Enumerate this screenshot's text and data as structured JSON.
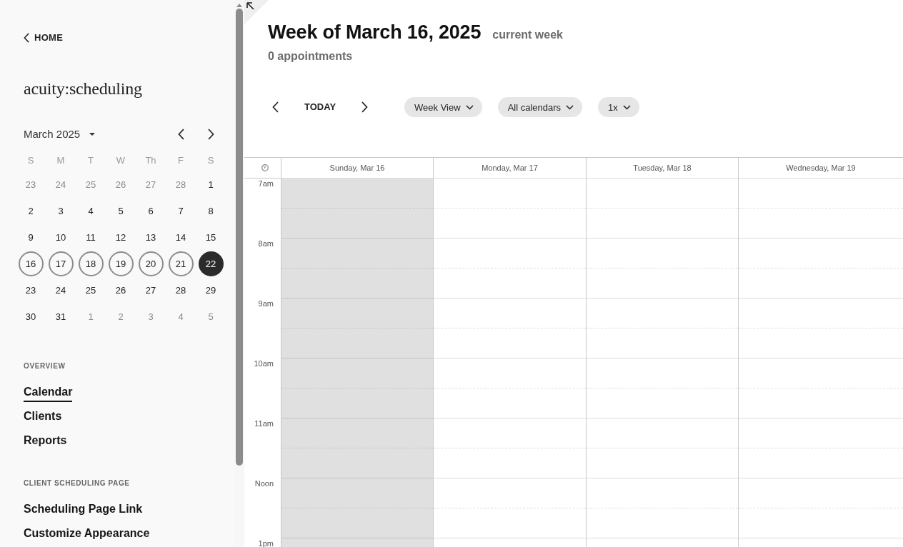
{
  "sidebar": {
    "back_link": {
      "label": "HOME"
    },
    "logo": "acuity:scheduling",
    "mini_calendar": {
      "month_label": "March 2025",
      "weekdays": [
        "S",
        "M",
        "T",
        "W",
        "Th",
        "F",
        "S"
      ],
      "weeks": [
        [
          {
            "label": "23",
            "other_month": true,
            "in_week": false,
            "today": false
          },
          {
            "label": "24",
            "other_month": true,
            "in_week": false,
            "today": false
          },
          {
            "label": "25",
            "other_month": true,
            "in_week": false,
            "today": false
          },
          {
            "label": "26",
            "other_month": true,
            "in_week": false,
            "today": false
          },
          {
            "label": "27",
            "other_month": true,
            "in_week": false,
            "today": false
          },
          {
            "label": "28",
            "other_month": true,
            "in_week": false,
            "today": false
          },
          {
            "label": "1",
            "other_month": false,
            "in_week": false,
            "today": false
          }
        ],
        [
          {
            "label": "2",
            "other_month": false,
            "in_week": false,
            "today": false
          },
          {
            "label": "3",
            "other_month": false,
            "in_week": false,
            "today": false
          },
          {
            "label": "4",
            "other_month": false,
            "in_week": false,
            "today": false
          },
          {
            "label": "5",
            "other_month": false,
            "in_week": false,
            "today": false
          },
          {
            "label": "6",
            "other_month": false,
            "in_week": false,
            "today": false
          },
          {
            "label": "7",
            "other_month": false,
            "in_week": false,
            "today": false
          },
          {
            "label": "8",
            "other_month": false,
            "in_week": false,
            "today": false
          }
        ],
        [
          {
            "label": "9",
            "other_month": false,
            "in_week": false,
            "today": false
          },
          {
            "label": "10",
            "other_month": false,
            "in_week": false,
            "today": false
          },
          {
            "label": "11",
            "other_month": false,
            "in_week": false,
            "today": false
          },
          {
            "label": "12",
            "other_month": false,
            "in_week": false,
            "today": false
          },
          {
            "label": "13",
            "other_month": false,
            "in_week": false,
            "today": false
          },
          {
            "label": "14",
            "other_month": false,
            "in_week": false,
            "today": false
          },
          {
            "label": "15",
            "other_month": false,
            "in_week": false,
            "today": false
          }
        ],
        [
          {
            "label": "16",
            "other_month": false,
            "in_week": true,
            "today": false
          },
          {
            "label": "17",
            "other_month": false,
            "in_week": true,
            "today": false
          },
          {
            "label": "18",
            "other_month": false,
            "in_week": true,
            "today": false
          },
          {
            "label": "19",
            "other_month": false,
            "in_week": true,
            "today": false
          },
          {
            "label": "20",
            "other_month": false,
            "in_week": true,
            "today": false
          },
          {
            "label": "21",
            "other_month": false,
            "in_week": true,
            "today": false
          },
          {
            "label": "22",
            "other_month": false,
            "in_week": true,
            "today": true
          }
        ],
        [
          {
            "label": "23",
            "other_month": false,
            "in_week": false,
            "today": false
          },
          {
            "label": "24",
            "other_month": false,
            "in_week": false,
            "today": false
          },
          {
            "label": "25",
            "other_month": false,
            "in_week": false,
            "today": false
          },
          {
            "label": "26",
            "other_month": false,
            "in_week": false,
            "today": false
          },
          {
            "label": "27",
            "other_month": false,
            "in_week": false,
            "today": false
          },
          {
            "label": "28",
            "other_month": false,
            "in_week": false,
            "today": false
          },
          {
            "label": "29",
            "other_month": false,
            "in_week": false,
            "today": false
          }
        ],
        [
          {
            "label": "30",
            "other_month": false,
            "in_week": false,
            "today": false
          },
          {
            "label": "31",
            "other_month": false,
            "in_week": false,
            "today": false
          },
          {
            "label": "1",
            "other_month": true,
            "in_week": false,
            "today": false
          },
          {
            "label": "2",
            "other_month": true,
            "in_week": false,
            "today": false
          },
          {
            "label": "3",
            "other_month": true,
            "in_week": false,
            "today": false
          },
          {
            "label": "4",
            "other_month": true,
            "in_week": false,
            "today": false
          },
          {
            "label": "5",
            "other_month": true,
            "in_week": false,
            "today": false
          }
        ]
      ]
    },
    "sections": [
      {
        "heading": "OVERVIEW",
        "items": [
          {
            "label": "Calendar",
            "selected": true
          },
          {
            "label": "Clients",
            "selected": false
          },
          {
            "label": "Reports",
            "selected": false
          }
        ]
      },
      {
        "heading": "CLIENT SCHEDULING PAGE",
        "items": [
          {
            "label": "Scheduling Page Link",
            "selected": false
          },
          {
            "label": "Customize Appearance",
            "selected": false
          }
        ]
      }
    ]
  },
  "header": {
    "title": "Week of March 16, 2025",
    "badge": "current week",
    "subtitle": "0 appointments"
  },
  "toolbar": {
    "today_button": "TODAY",
    "dropdowns": [
      {
        "label": "Week View"
      },
      {
        "label": "All calendars"
      },
      {
        "label": "1x"
      }
    ]
  },
  "schedule": {
    "days": [
      {
        "label": "Sunday, Mar 16",
        "shaded": true
      },
      {
        "label": "Monday, Mar 17",
        "shaded": false
      },
      {
        "label": "Tuesday, Mar 18",
        "shaded": false
      },
      {
        "label": "Wednesday, Mar 19",
        "shaded": false
      }
    ],
    "hours": [
      "7am",
      "8am",
      "9am",
      "10am",
      "11am",
      "Noon",
      "1pm"
    ]
  }
}
